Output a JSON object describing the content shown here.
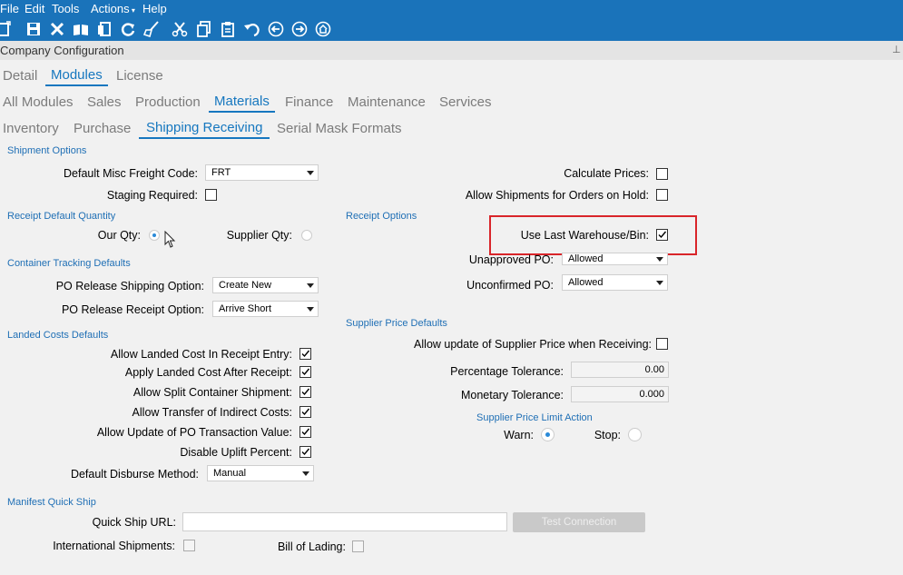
{
  "menu": [
    "File",
    "Edit",
    "Tools",
    "Actions",
    "Help"
  ],
  "panel_title": "Company Configuration",
  "pin_glyph": "⊥",
  "tabs_main": [
    "Detail",
    "Modules",
    "License"
  ],
  "tabs_modules": [
    "All Modules",
    "Sales",
    "Production",
    "Materials",
    "Finance",
    "Maintenance",
    "Services"
  ],
  "tabs_materials": [
    "Inventory",
    "Purchase",
    "Shipping Receiving",
    "Serial Mask Formats"
  ],
  "sections": {
    "shipment_options": "Shipment Options",
    "receipt_default_qty": "Receipt Default Quantity",
    "container_tracking": "Container Tracking Defaults",
    "landed_costs": "Landed Costs Defaults",
    "manifest_quick_ship": "Manifest Quick Ship",
    "receipt_options": "Receipt Options",
    "supplier_price_defaults": "Supplier Price Defaults",
    "supplier_price_limit_action": "Supplier Price Limit Action"
  },
  "fields": {
    "default_misc_freight_code": {
      "label": "Default Misc Freight Code:",
      "value": "FRT"
    },
    "staging_required": {
      "label": "Staging Required:",
      "checked": false
    },
    "calculate_prices": {
      "label": "Calculate Prices:",
      "checked": false
    },
    "allow_shipments_on_hold": {
      "label": "Allow Shipments for Orders on Hold:",
      "checked": false
    },
    "our_qty": {
      "label": "Our Qty:",
      "selected": true
    },
    "supplier_qty": {
      "label": "Supplier Qty:",
      "selected": false
    },
    "use_last_warehouse_bin": {
      "label": "Use Last Warehouse/Bin:",
      "checked": true
    },
    "unapproved_po": {
      "label": "Unapproved PO:",
      "value": "Allowed"
    },
    "unconfirmed_po": {
      "label": "Unconfirmed PO:",
      "value": "Allowed"
    },
    "po_release_shipping_option": {
      "label": "PO Release Shipping Option:",
      "value": "Create New"
    },
    "po_release_receipt_option": {
      "label": "PO Release Receipt Option:",
      "value": "Arrive Short"
    },
    "allow_landed_cost_receipt_entry": {
      "label": "Allow Landed Cost In Receipt Entry:",
      "checked": true
    },
    "apply_landed_cost_after_receipt": {
      "label": "Apply Landed Cost After Receipt:",
      "checked": true
    },
    "allow_split_container_shipment": {
      "label": "Allow Split Container Shipment:",
      "checked": true
    },
    "allow_transfer_indirect_costs": {
      "label": "Allow Transfer of Indirect Costs:",
      "checked": true
    },
    "allow_update_po_transaction_value": {
      "label": "Allow Update of PO Transaction Value:",
      "checked": true
    },
    "disable_uplift_percent": {
      "label": "Disable Uplift Percent:",
      "checked": true
    },
    "default_disburse_method": {
      "label": "Default Disburse Method:",
      "value": "Manual"
    },
    "allow_update_supplier_price": {
      "label": "Allow update of Supplier Price when Receiving:",
      "checked": false
    },
    "percentage_tolerance": {
      "label": "Percentage Tolerance:",
      "value": "0.00"
    },
    "monetary_tolerance": {
      "label": "Monetary Tolerance:",
      "value": "0.000"
    },
    "warn": {
      "label": "Warn:",
      "selected": true
    },
    "stop": {
      "label": "Stop:",
      "selected": false
    },
    "quick_ship_url": {
      "label": "Quick Ship URL:",
      "value": ""
    },
    "test_connection": {
      "label": "Test Connection"
    },
    "international_shipments": {
      "label": "International Shipments:",
      "checked": false
    },
    "bill_of_lading": {
      "label": "Bill of Lading:",
      "checked": false
    }
  },
  "colors": {
    "toolbar_blue": "#1a73ba",
    "accent": "#1677bf",
    "section": "#1f6fb5",
    "highlight": "#d9252a"
  },
  "toolbar_icons": [
    "new-icon",
    "save-icon",
    "delete-icon",
    "book-icon",
    "attach-icon",
    "refresh-icon",
    "clear-icon",
    "cut-icon",
    "copy-icon",
    "paste-icon",
    "undo-icon",
    "back-icon",
    "forward-icon",
    "home-icon"
  ]
}
